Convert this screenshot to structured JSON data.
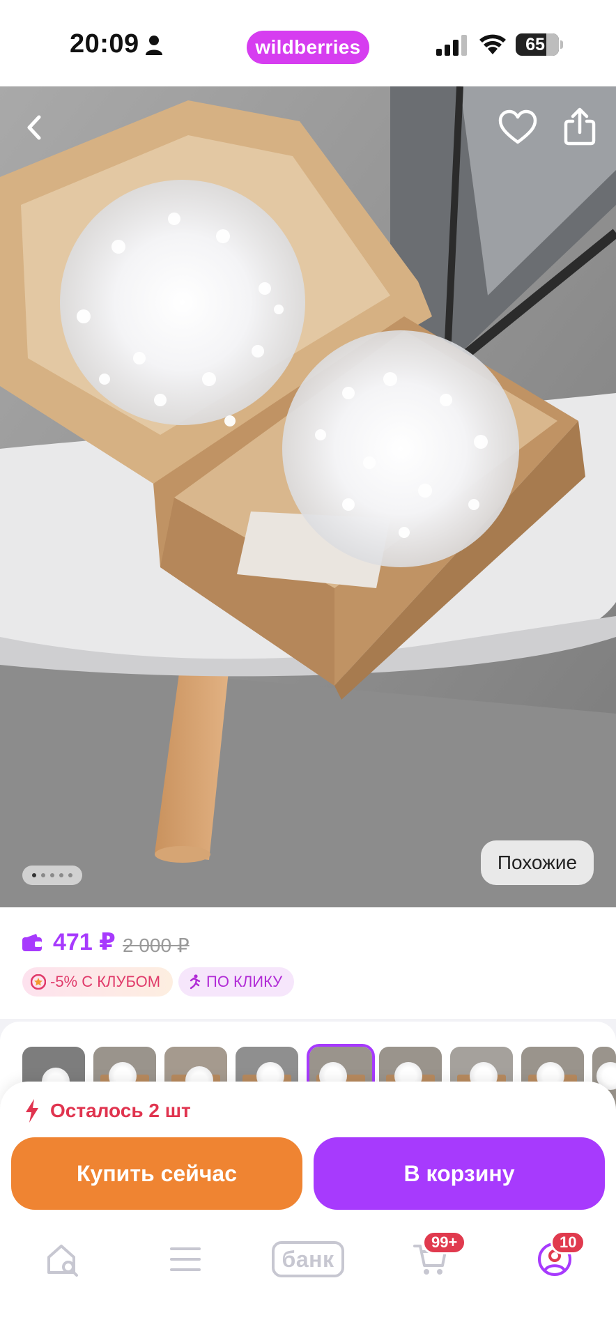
{
  "status_bar": {
    "time": "20:09",
    "brand": "wildberries",
    "battery": "65",
    "brand_color": "#d63df0"
  },
  "photo": {
    "similar_label": "Похожие",
    "dots_total": 5,
    "dots_active_index": 0
  },
  "price": {
    "current": "471 ₽",
    "old": "2 000 ₽",
    "accent_color": "#a73afd"
  },
  "badges": {
    "club": "-5% С КЛУБОМ",
    "click": "ПО КЛИКУ"
  },
  "thumbnails": {
    "count": 9,
    "selected_index": 4
  },
  "sheet": {
    "stock": "Осталось 2 шт",
    "buy_now": "Купить сейчас",
    "add_to_cart": "В корзину",
    "buy_color": "#ef8432",
    "cart_color": "#a73afd"
  },
  "tabbar": {
    "bank_label": "банк",
    "cart_badge": "99+",
    "profile_badge": "10",
    "icons": [
      "home-search-icon",
      "catalog-menu-icon",
      "bank-icon",
      "cart-icon",
      "profile-icon"
    ]
  }
}
